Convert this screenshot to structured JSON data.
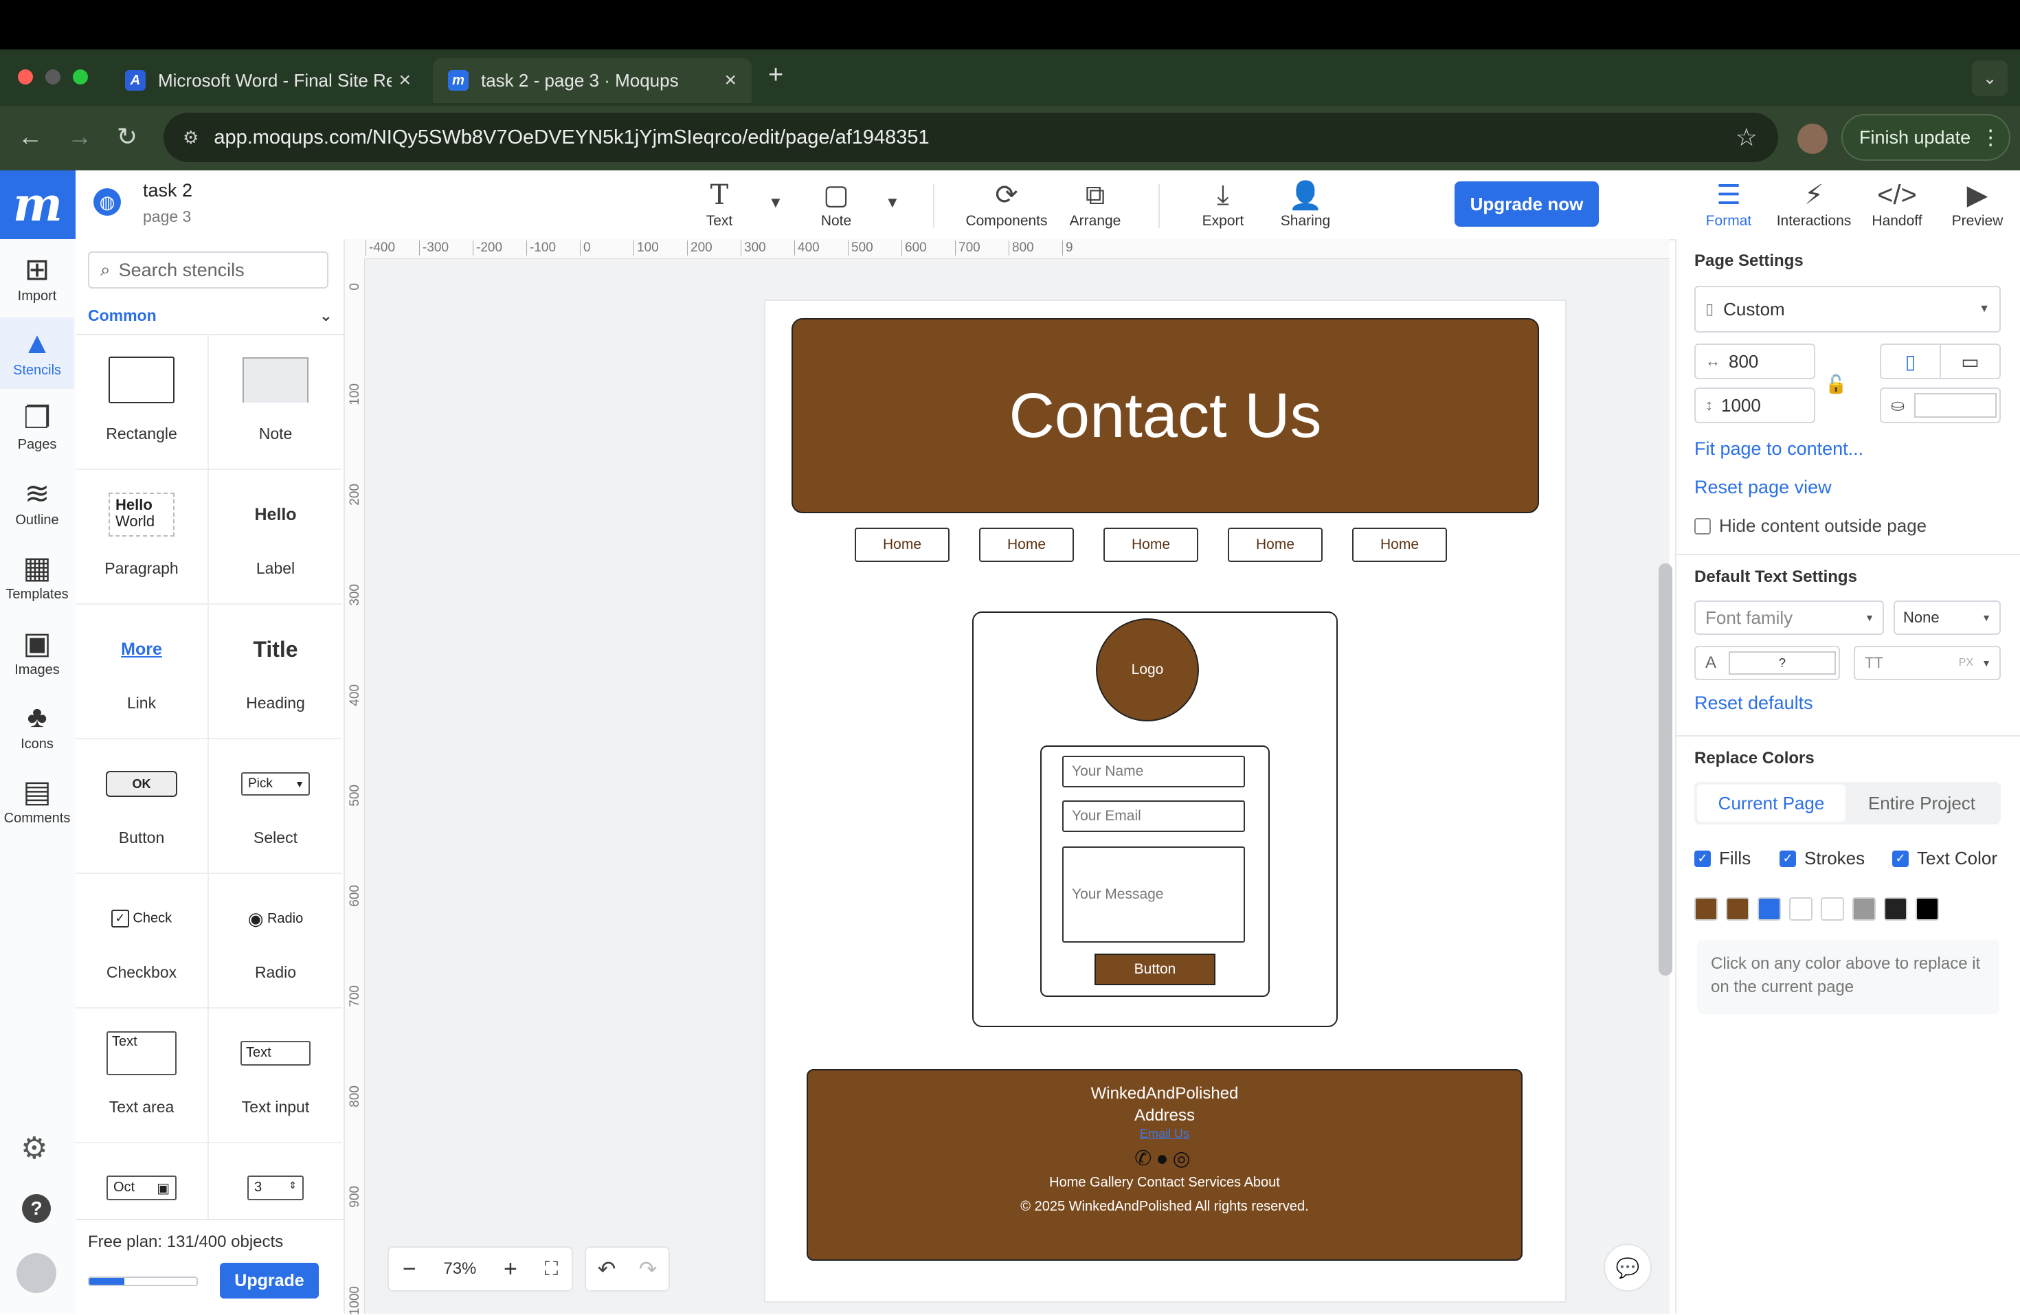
{
  "browser": {
    "tabs": [
      {
        "title": "Microsoft Word - Final Site Re",
        "icon": "word-icon",
        "active": false
      },
      {
        "title": "task 2 - page 3 · Moqups",
        "icon": "moqups-icon",
        "active": true
      }
    ],
    "url": "app.moqups.com/NIQy5SWb8V7OeDVEYN5k1jYjmSIeqrco/edit/page/af1948351",
    "finish_update": "Finish update"
  },
  "app": {
    "logo": "m",
    "project_title": "task 2",
    "page_name": "page 3",
    "toolbar": {
      "text": "Text",
      "note": "Note",
      "components": "Components",
      "arrange": "Arrange",
      "export": "Export",
      "sharing": "Sharing",
      "upgrade_now": "Upgrade now",
      "format": "Format",
      "interactions": "Interactions",
      "handoff": "Handoff",
      "preview": "Preview"
    },
    "rail": {
      "import": "Import",
      "stencils": "Stencils",
      "pages": "Pages",
      "outline": "Outline",
      "templates": "Templates",
      "images": "Images",
      "icons": "Icons",
      "comments": "Comments"
    }
  },
  "stencils": {
    "search_placeholder": "Search stencils",
    "category": "Common",
    "items": [
      {
        "label": "Rectangle"
      },
      {
        "label": "Note"
      },
      {
        "label": "Paragraph",
        "preview_line1": "Hello",
        "preview_line2": "World"
      },
      {
        "label": "Label",
        "preview": "Hello"
      },
      {
        "label": "Link",
        "preview": "More"
      },
      {
        "label": "Heading",
        "preview": "Title"
      },
      {
        "label": "Button",
        "preview": "OK"
      },
      {
        "label": "Select",
        "preview": "Pick"
      },
      {
        "label": "Checkbox",
        "preview": "Check"
      },
      {
        "label": "Radio",
        "preview": "Radio"
      },
      {
        "label": "Text area",
        "preview": "Text"
      },
      {
        "label": "Text input",
        "preview": "Text"
      },
      {
        "label": "",
        "preview": "Oct"
      },
      {
        "label": "",
        "preview": "3"
      }
    ],
    "plan_text": "Free plan: 131/400 objects",
    "plan_progress": 0.33,
    "upgrade": "Upgrade"
  },
  "canvas": {
    "ruler_top": [
      "-400",
      "-300",
      "-200",
      "-100",
      "0",
      "100",
      "200",
      "300",
      "400",
      "500",
      "600",
      "700",
      "800",
      "9"
    ],
    "ruler_left": [
      "0",
      "100",
      "200",
      "300",
      "400",
      "500",
      "600",
      "700",
      "800",
      "900",
      "1000"
    ],
    "zoom": "73%",
    "mockup": {
      "hero_title": "Contact Us",
      "nav": [
        "Home",
        "Home",
        "Home",
        "Home",
        "Home"
      ],
      "logo": "Logo",
      "name_placeholder": "Your Name",
      "email_placeholder": "Your Email",
      "message_placeholder": "Your Message",
      "button": "Button",
      "footer": {
        "brand": "WinkedAndPolished",
        "address": "Address",
        "email_link": "Email Us",
        "links": "Home Gallery Contact Services About",
        "copyright": "© 2025 WinkedAndPolished All rights reserved."
      }
    }
  },
  "format_panel": {
    "page_settings": "Page Settings",
    "preset": "Custom",
    "width": "800",
    "height": "1000",
    "fit_page": "Fit page to content...",
    "reset_view": "Reset page view",
    "hide_outside": "Hide content outside page",
    "default_text": "Default Text Settings",
    "font_family": "Font family",
    "font_weight": "None",
    "font_color": "?",
    "font_size_unit": "PX",
    "reset_defaults": "Reset defaults",
    "replace_colors": "Replace Colors",
    "tab_current": "Current Page",
    "tab_project": "Entire Project",
    "fills": "Fills",
    "strokes": "Strokes",
    "text_color": "Text Color",
    "swatches": [
      "#7a4a1f",
      "#7a4a1f",
      "#2b6fe6",
      "#ffffff",
      "#ffffff",
      "#999999",
      "#222222",
      "#000000"
    ],
    "hint": "Click on any color above to replace it on the current page"
  },
  "colors": {
    "brand_blue": "#2b6fe6",
    "mockup_brown": "#7a4a1f"
  }
}
